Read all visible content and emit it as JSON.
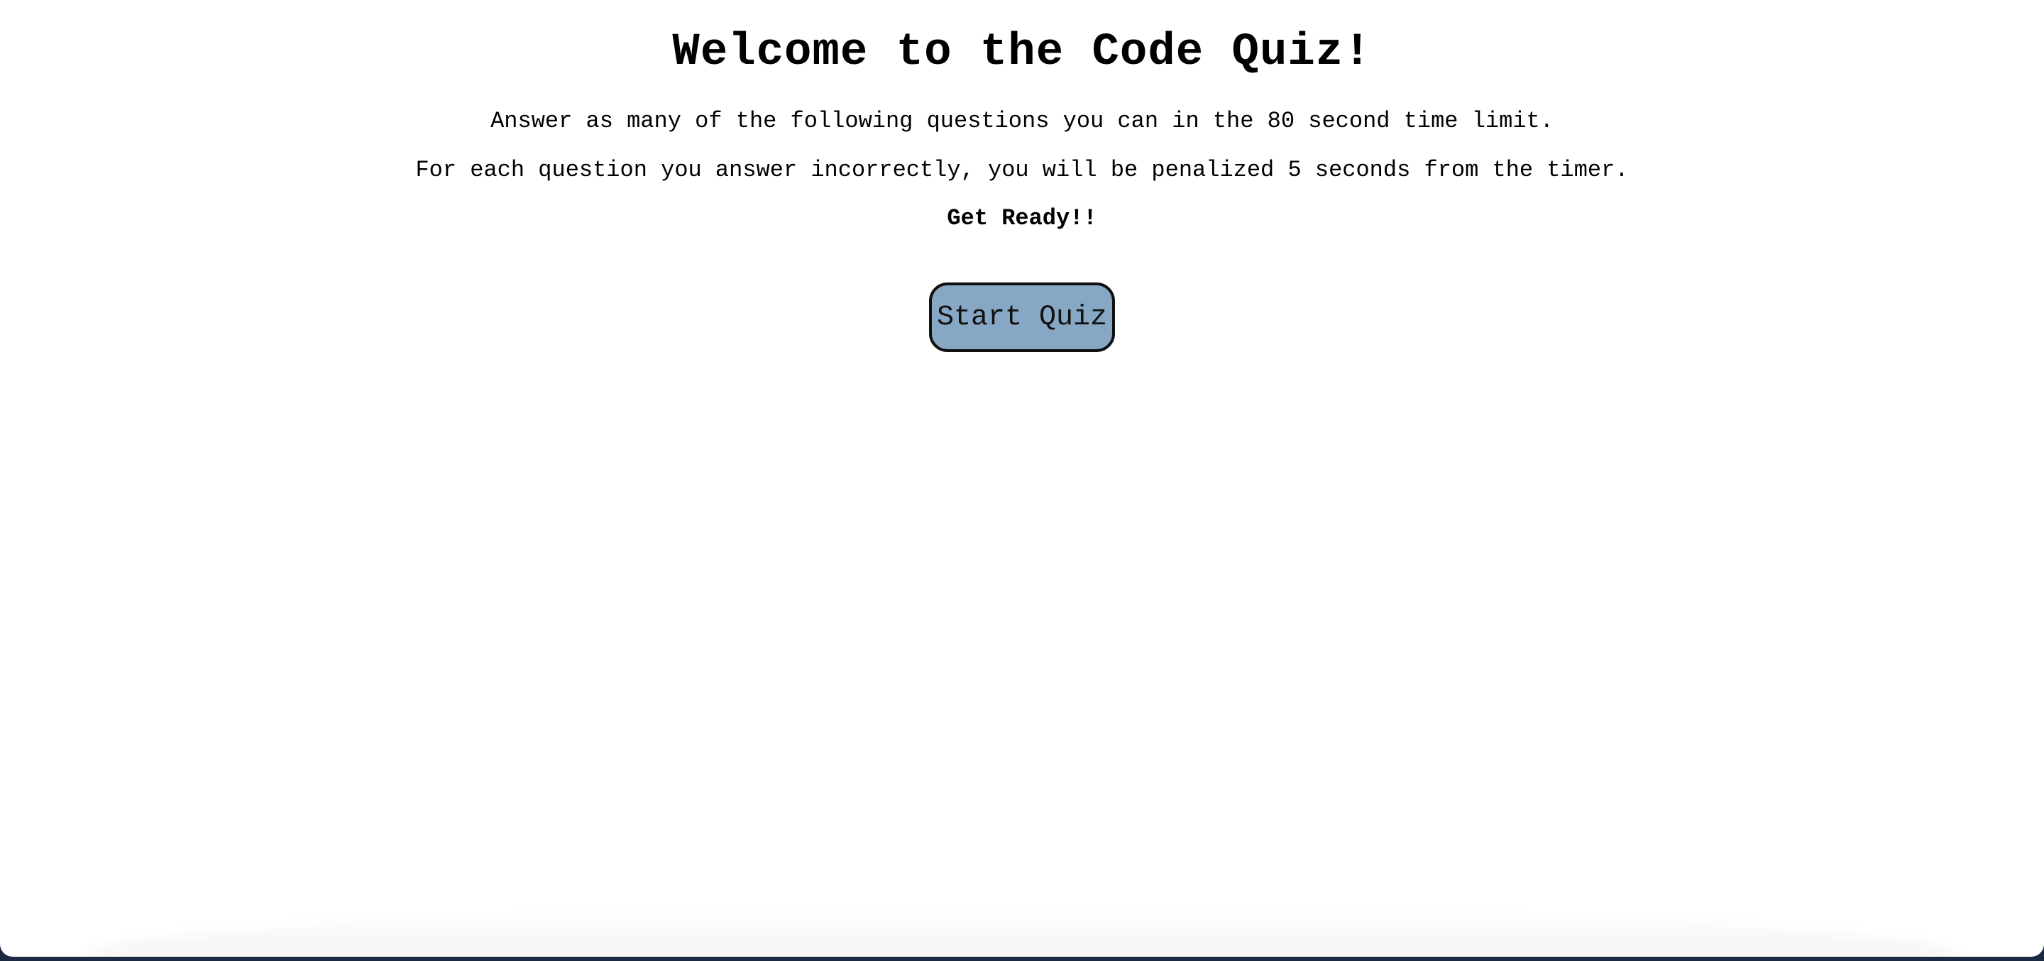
{
  "page": {
    "title": "Welcome to the Code Quiz!",
    "instructions": [
      "Answer as many of the following questions you can in the 80 second time limit.",
      "For each question you answer incorrectly, you will be penalized 5 seconds from the timer."
    ],
    "ready_text": "Get Ready!!",
    "start_button_label": "Start Quiz"
  },
  "colors": {
    "background": "#ffffff",
    "button_fill": "#87a8c5",
    "button_border": "#111111",
    "text": "#000000"
  }
}
